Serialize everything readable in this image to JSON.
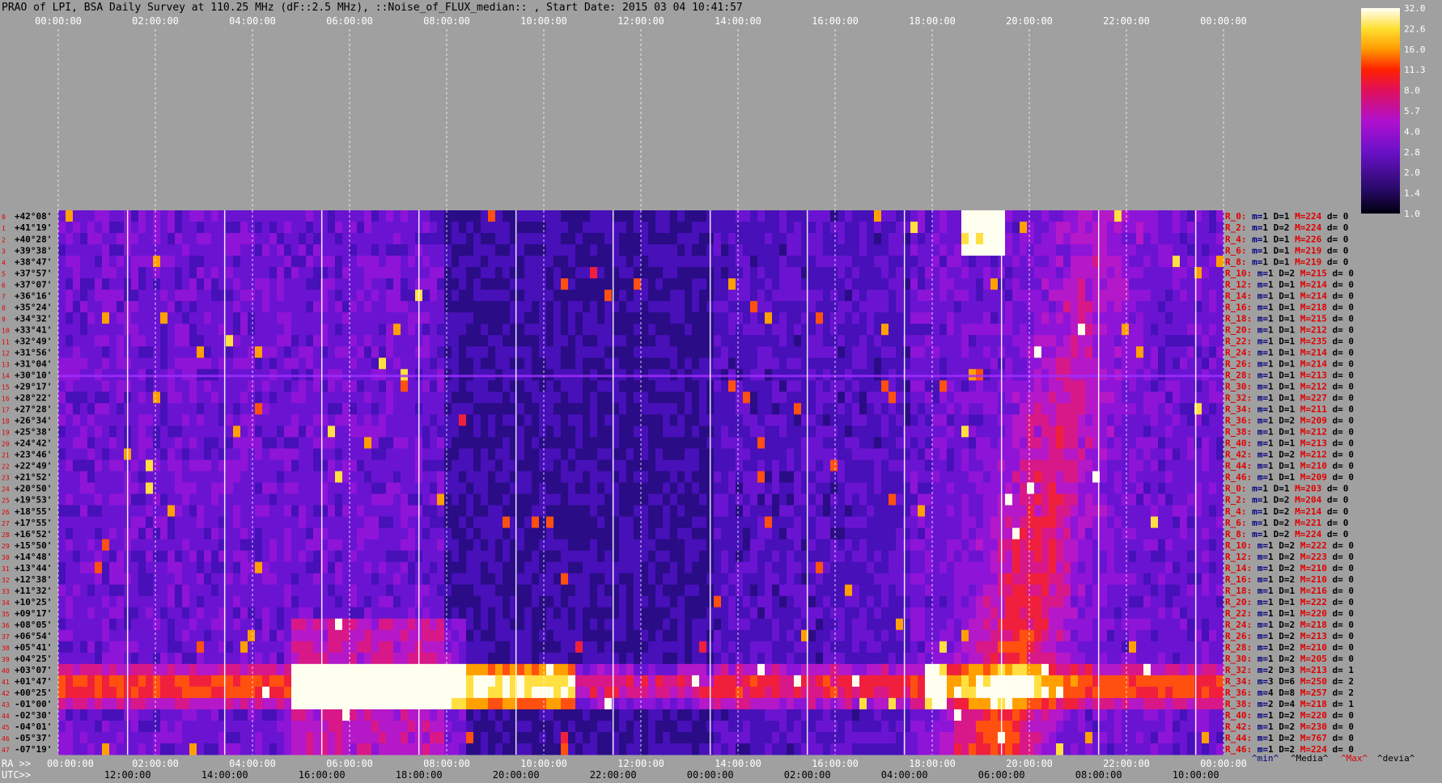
{
  "chart_data": {
    "type": "heatmap",
    "title": "PRAO of LPI, BSA Daily Survey at 110.25 MHz (dF::2.5 MHz), ::Noise_of_FLUX_median:: , Start Date: 2015 03 04 10:41:57",
    "top_axis_labels": [
      "00:00:00",
      "02:00:00",
      "04:00:00",
      "06:00:00",
      "08:00:00",
      "10:00:00",
      "12:00:00",
      "14:00:00",
      "16:00:00",
      "18:00:00",
      "20:00:00",
      "22:00:00",
      "00:00:00"
    ],
    "ra_axis": {
      "prefix": "RA >>",
      "labels": [
        "00:00:00",
        "02:00:00",
        "04:00:00",
        "06:00:00",
        "08:00:00",
        "10:00:00",
        "12:00:00",
        "14:00:00",
        "16:00:00",
        "18:00:00",
        "20:00:00",
        "22:00:00",
        "00:00:00"
      ]
    },
    "utc_axis": {
      "prefix": "UTC>>",
      "labels": [
        "12:00:00",
        "14:00:00",
        "16:00:00",
        "18:00:00",
        "20:00:00",
        "22:00:00",
        "00:00:00",
        "02:00:00",
        "04:00:00",
        "06:00:00",
        "08:00:00",
        "10:00:00"
      ]
    },
    "colorbar": {
      "ticks": [
        "32.0",
        "22.6",
        "16.0",
        "11.3",
        "8.0",
        "5.7",
        "4.0",
        "2.8",
        "2.0",
        "1.4",
        "1.0"
      ],
      "range": [
        1.0,
        32.0
      ],
      "scale": "log"
    },
    "declinations": [
      "+42°08'",
      "+41°19'",
      "+40°28'",
      "+39°38'",
      "+38°47'",
      "+37°57'",
      "+37°07'",
      "+36°16'",
      "+35°24'",
      "+34°32'",
      "+33°41'",
      "+32°49'",
      "+31°56'",
      "+31°04'",
      "+30°10'",
      "+29°17'",
      "+28°22'",
      "+27°28'",
      "+26°34'",
      "+25°38'",
      "+24°42'",
      "+23°46'",
      "+22°49'",
      "+21°52'",
      "+20°50'",
      "+19°53'",
      "+18°55'",
      "+17°55'",
      "+16°52'",
      "+15°50'",
      "+14°48'",
      "+13°44'",
      "+12°38'",
      "+11°32'",
      "+10°25'",
      "+09°17'",
      "+08°05'",
      "+06°54'",
      "+05°41'",
      "+04°25'",
      "+03°07'",
      "+01°47'",
      "+00°25'",
      "-01°00'",
      "-02°30'",
      "-04°01'",
      "-05°37'",
      "-07°19'"
    ],
    "rows": [
      {
        "r": "R_0:",
        "m": "1",
        "D": "1",
        "M": "224",
        "d": "0"
      },
      {
        "r": "R_2:",
        "m": "1",
        "D": "2",
        "M": "224",
        "d": "0"
      },
      {
        "r": "R_4:",
        "m": "1",
        "D": "1",
        "M": "226",
        "d": "0"
      },
      {
        "r": "R_6:",
        "m": "1",
        "D": "1",
        "M": "219",
        "d": "0"
      },
      {
        "r": "R_8:",
        "m": "1",
        "D": "1",
        "M": "219",
        "d": "0"
      },
      {
        "r": "R_10:",
        "m": "1",
        "D": "2",
        "M": "215",
        "d": "0"
      },
      {
        "r": "R_12:",
        "m": "1",
        "D": "1",
        "M": "214",
        "d": "0"
      },
      {
        "r": "R_14:",
        "m": "1",
        "D": "1",
        "M": "214",
        "d": "0"
      },
      {
        "r": "R_16:",
        "m": "1",
        "D": "1",
        "M": "218",
        "d": "0"
      },
      {
        "r": "R_18:",
        "m": "1",
        "D": "1",
        "M": "215",
        "d": "0"
      },
      {
        "r": "R_20:",
        "m": "1",
        "D": "1",
        "M": "212",
        "d": "0"
      },
      {
        "r": "R_22:",
        "m": "1",
        "D": "1",
        "M": "235",
        "d": "0"
      },
      {
        "r": "R_24:",
        "m": "1",
        "D": "1",
        "M": "214",
        "d": "0"
      },
      {
        "r": "R_26:",
        "m": "1",
        "D": "1",
        "M": "214",
        "d": "0"
      },
      {
        "r": "R_28:",
        "m": "1",
        "D": "1",
        "M": "213",
        "d": "0"
      },
      {
        "r": "R_30:",
        "m": "1",
        "D": "1",
        "M": "212",
        "d": "0"
      },
      {
        "r": "R_32:",
        "m": "1",
        "D": "1",
        "M": "227",
        "d": "0"
      },
      {
        "r": "R_34:",
        "m": "1",
        "D": "1",
        "M": "211",
        "d": "0"
      },
      {
        "r": "R_36:",
        "m": "1",
        "D": "2",
        "M": "209",
        "d": "0"
      },
      {
        "r": "R_38:",
        "m": "1",
        "D": "1",
        "M": "212",
        "d": "0"
      },
      {
        "r": "R_40:",
        "m": "1",
        "D": "1",
        "M": "213",
        "d": "0"
      },
      {
        "r": "R_42:",
        "m": "1",
        "D": "2",
        "M": "212",
        "d": "0"
      },
      {
        "r": "R_44:",
        "m": "1",
        "D": "1",
        "M": "210",
        "d": "0"
      },
      {
        "r": "R_46:",
        "m": "1",
        "D": "1",
        "M": "209",
        "d": "0"
      },
      {
        "r": "R_0:",
        "m": "1",
        "D": "1",
        "M": "203",
        "d": "0"
      },
      {
        "r": "R_2:",
        "m": "1",
        "D": "2",
        "M": "204",
        "d": "0"
      },
      {
        "r": "R_4:",
        "m": "1",
        "D": "2",
        "M": "214",
        "d": "0"
      },
      {
        "r": "R_6:",
        "m": "1",
        "D": "2",
        "M": "221",
        "d": "0"
      },
      {
        "r": "R_8:",
        "m": "1",
        "D": "2",
        "M": "224",
        "d": "0"
      },
      {
        "r": "R_10:",
        "m": "1",
        "D": "2",
        "M": "222",
        "d": "0"
      },
      {
        "r": "R_12:",
        "m": "1",
        "D": "2",
        "M": "223",
        "d": "0"
      },
      {
        "r": "R_14:",
        "m": "1",
        "D": "2",
        "M": "210",
        "d": "0"
      },
      {
        "r": "R_16:",
        "m": "1",
        "D": "2",
        "M": "210",
        "d": "0"
      },
      {
        "r": "R_18:",
        "m": "1",
        "D": "1",
        "M": "216",
        "d": "0"
      },
      {
        "r": "R_20:",
        "m": "1",
        "D": "1",
        "M": "222",
        "d": "0"
      },
      {
        "r": "R_22:",
        "m": "1",
        "D": "1",
        "M": "220",
        "d": "0"
      },
      {
        "r": "R_24:",
        "m": "1",
        "D": "2",
        "M": "218",
        "d": "0"
      },
      {
        "r": "R_26:",
        "m": "1",
        "D": "2",
        "M": "213",
        "d": "0"
      },
      {
        "r": "R_28:",
        "m": "1",
        "D": "2",
        "M": "210",
        "d": "0"
      },
      {
        "r": "R_30:",
        "m": "1",
        "D": "2",
        "M": "205",
        "d": "0"
      },
      {
        "r": "R_32:",
        "m": "2",
        "D": "3",
        "M": "213",
        "d": "1"
      },
      {
        "r": "R_34:",
        "m": "3",
        "D": "6",
        "M": "250",
        "d": "2"
      },
      {
        "r": "R_36:",
        "m": "4",
        "D": "8",
        "M": "257",
        "d": "2"
      },
      {
        "r": "R_38:",
        "m": "2",
        "D": "4",
        "M": "218",
        "d": "1"
      },
      {
        "r": "R_40:",
        "m": "1",
        "D": "2",
        "M": "220",
        "d": "0"
      },
      {
        "r": "R_42:",
        "m": "1",
        "D": "2",
        "M": "230",
        "d": "0"
      },
      {
        "r": "R_44:",
        "m": "1",
        "D": "2",
        "M": "767",
        "d": "0"
      },
      {
        "r": "R_46:",
        "m": "1",
        "D": "2",
        "M": "224",
        "d": "0"
      }
    ],
    "stats_legend": {
      "min": "^min^",
      "media": "^Media^",
      "max": "^Max^",
      "devia": "^devia^"
    },
    "colors": {
      "background": "#a0a0a0",
      "label_red": "#e00000",
      "label_dark": "#000080",
      "text": "#ffffff"
    }
  }
}
